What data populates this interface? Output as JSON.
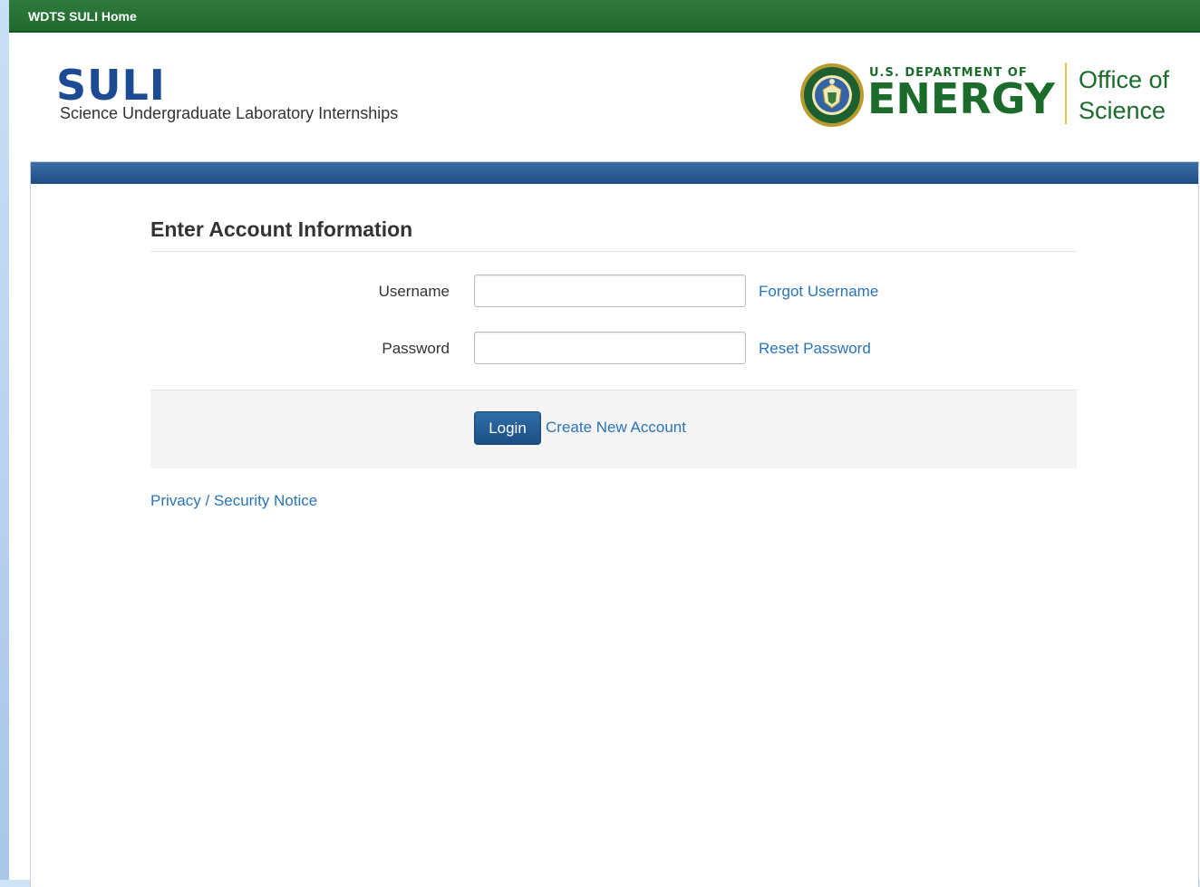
{
  "topbar": {
    "home_link": "WDTS SULI Home"
  },
  "header": {
    "suli_logo": {
      "acronym": "SULI",
      "subtitle": "Science Undergraduate Laboratory Internships"
    },
    "doe_logo": {
      "department_line": "U.S. DEPARTMENT OF",
      "energy_text": "ENERGY",
      "office_line1": "Office of",
      "office_line2": "Science",
      "seal_icon": "doe-seal-icon"
    }
  },
  "form": {
    "heading": "Enter Account Information",
    "username": {
      "label": "Username",
      "value": "",
      "placeholder": ""
    },
    "password": {
      "label": "Password",
      "value": "",
      "placeholder": ""
    },
    "forgot_username_link": "Forgot Username",
    "reset_password_link": "Reset Password",
    "login_button": "Login",
    "create_account_link": "Create New Account"
  },
  "footer": {
    "privacy_link": "Privacy / Security Notice"
  },
  "colors": {
    "topbar_green": "#1f6a2d",
    "brand_blue": "#1c4a93",
    "doe_green": "#1b6b2b",
    "link_blue": "#2a74b8",
    "band_blue": "#1f4e84",
    "gold_divider": "#e3c35a"
  }
}
